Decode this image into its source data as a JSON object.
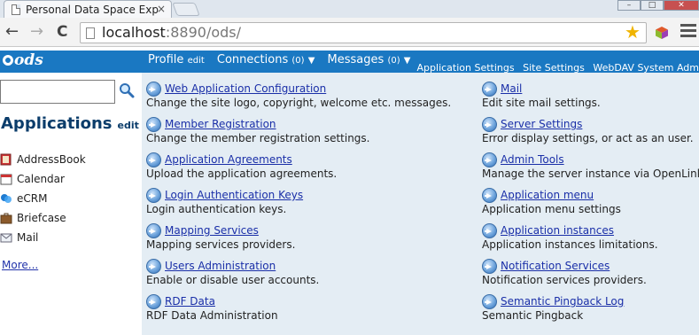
{
  "browser": {
    "tab_title": "Personal Data Space Exp",
    "tab_close": "×",
    "url_host": "localhost",
    "url_rest": ":8890/ods/",
    "back": "←",
    "forward": "→",
    "reload": "C",
    "star": "★"
  },
  "header": {
    "logo": "ods",
    "nav": {
      "profile": "Profile",
      "profile_edit": "edit",
      "connections": "Connections",
      "connections_count": "(0)",
      "messages": "Messages",
      "messages_count": "(0)",
      "arrow": "▼"
    },
    "admin_links": [
      "Application Settings",
      "Site Settings",
      "WebDAV System Adm"
    ]
  },
  "sidebar": {
    "search_value": "",
    "title": "Applications",
    "title_edit": "edit",
    "apps": [
      "AddressBook",
      "Calendar",
      "eCRM",
      "Briefcase",
      "Mail"
    ],
    "more": "More..."
  },
  "main": {
    "left": [
      {
        "label": "Web Application Configuration",
        "desc": "Change the site logo, copyright, welcome etc. messages."
      },
      {
        "label": "Member Registration",
        "desc": "Change the member registration settings."
      },
      {
        "label": "Application Agreements",
        "desc": "Upload the application agreements."
      },
      {
        "label": "Login Authentication Keys",
        "desc": "Login authentication keys."
      },
      {
        "label": "Mapping Services",
        "desc": "Mapping services providers."
      },
      {
        "label": "Users Administration",
        "desc": "Enable or disable user accounts."
      },
      {
        "label": "RDF Data",
        "desc": "RDF Data Administration"
      }
    ],
    "right": [
      {
        "label": "Mail",
        "desc": "Edit site mail settings."
      },
      {
        "label": "Server Settings",
        "desc": "Error display settings, or act as an user."
      },
      {
        "label": "Admin Tools",
        "desc": "Manage the server instance via OpenLink"
      },
      {
        "label": "Application menu",
        "desc": "Application menu settings"
      },
      {
        "label": "Application instances",
        "desc": "Application instances limitations."
      },
      {
        "label": "Notification Services",
        "desc": "Notification services providers."
      },
      {
        "label": "Semantic Pingback Log",
        "desc": "Semantic Pingback"
      }
    ]
  }
}
